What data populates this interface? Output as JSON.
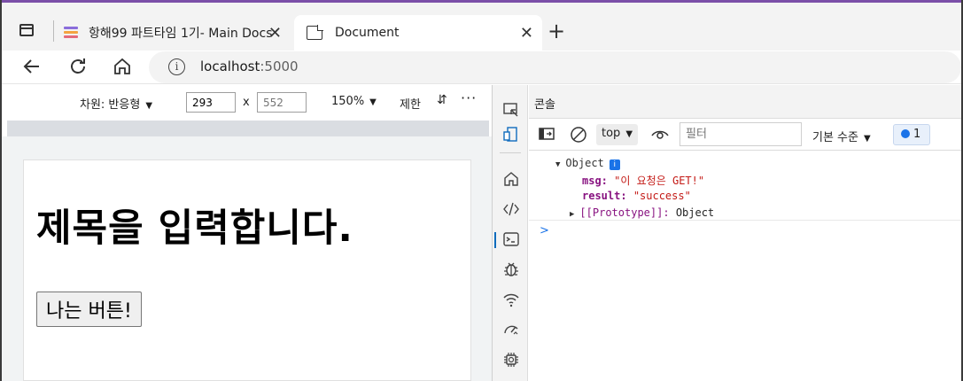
{
  "browser": {
    "tabs": [
      {
        "title": "항해99 파트타임 1기- Main Docs",
        "close": "✕"
      },
      {
        "title": "Document",
        "close": "✕"
      }
    ],
    "new_tab": "+",
    "address": {
      "info": "i",
      "host": "localhost",
      "port": ":5000"
    }
  },
  "device_toolbar": {
    "dimensions_label": "차원: 반응형",
    "width": "293",
    "height_placeholder": "552",
    "times": "x",
    "zoom": "150%",
    "throttle": "제한",
    "rotate_icon": "⇵",
    "more": "···"
  },
  "page": {
    "heading": "제목을 입력합니다.",
    "button_label": "나는 버튼!"
  },
  "devtools": {
    "panel_title": "콘솔",
    "context": "top",
    "filter_placeholder": "필터",
    "level": "기본 수준",
    "message_count": "1",
    "log": {
      "object_label": "Object",
      "info": "i",
      "msg_key": "msg:",
      "msg_value": "\"이 요청은 GET!\"",
      "result_key": "result:",
      "result_value": "\"success\"",
      "proto_key": "[[Prototype]]:",
      "proto_value": "Object"
    },
    "prompt": ">"
  },
  "icons": [
    "tab-actions-icon",
    "back-icon",
    "reload-icon",
    "home-icon",
    "info-icon",
    "inspect-icon",
    "device-emulation-icon",
    "welcome-icon",
    "elements-icon",
    "console-icon",
    "sources-icon",
    "network-icon",
    "performance-icon",
    "memory-icon",
    "clear-console-icon",
    "sidebar-toggle-icon",
    "live-expression-icon"
  ]
}
